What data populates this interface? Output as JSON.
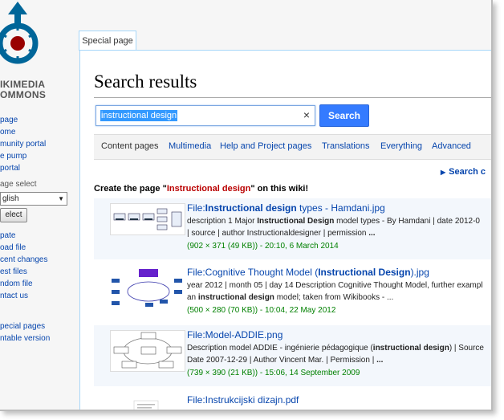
{
  "logo": {
    "line1": "IKIMEDIA",
    "line2": "OMMONS"
  },
  "nav_main": [
    "page",
    "ome",
    "munity portal",
    "e pump",
    "portal"
  ],
  "language": {
    "heading": "age select",
    "selected": "glish",
    "select_label": "elect"
  },
  "nav_tools": [
    "pate",
    "oad file",
    "cent changes",
    "est files",
    "ndom file",
    "ntact us"
  ],
  "nav_print": [
    "pecial pages",
    "ntable version"
  ],
  "tab_label": "Special page",
  "page_title": "Search results",
  "search": {
    "query": "instructional design",
    "clear": "×",
    "button": "Search"
  },
  "profiles": [
    "Content pages",
    "Multimedia",
    "Help and Project pages",
    "Translations",
    "Everything",
    "Advanced"
  ],
  "search_tools": "Search c",
  "create": {
    "prefix": "Create the page \"",
    "term": "Instructional design",
    "suffix": "\" on this wiki!"
  },
  "results": [
    {
      "title_a": "File:",
      "title_b": "Instructional design",
      "title_c": " types - Hamdani.jpg",
      "line1_a": "description 1 Major ",
      "line1_b": "Instructional Design",
      "line1_c": " model types - By Hamdani | date 2012-0",
      "line2_a": "| source | author Instructionaldesigner | permission ",
      "line2_b": "...",
      "line2_c": "",
      "meta": "(902 × 371 (49 KB)) - 20:10, 6 March 2014"
    },
    {
      "title_a": "File:Cognitive Thought Model (",
      "title_b": "Instructional Design",
      "title_c": ").jpg",
      "line1_a": "year 2012 | month 05 | day 14 Description Cognitive Thought Model, further exampl",
      "line1_b": "",
      "line1_c": "",
      "line2_a": "an ",
      "line2_b": "instructional design",
      "line2_c": " model; taken from Wikibooks - ...",
      "meta": "(500 × 280 (70 KB)) - 10:04, 22 May 2012"
    },
    {
      "title_a": "File:Model-ADDIE.png",
      "title_b": "",
      "title_c": "",
      "line1_a": "Description model ADDIE - ingénierie pédagogique (",
      "line1_b": "instructional design",
      "line1_c": ") | Source",
      "line2_a": "Date 2007-12-29 | Author Vincent Mar. | Permission | ",
      "line2_b": "...",
      "line2_c": "",
      "meta": "(739 × 390 (21 KB)) - 15:06, 14 September 2009"
    },
    {
      "title_a": "File:Instrukcijski dizajn.pdf",
      "title_b": "",
      "title_c": "",
      "line1_a": "",
      "line1_b": "",
      "line1_c": "",
      "line2_a": "",
      "line2_b": "",
      "line2_c": "",
      "meta": ""
    }
  ],
  "colors": {
    "link": "#0645ad",
    "meta": "#008000",
    "accent": "#347bff",
    "red_link": "#ba0000"
  }
}
